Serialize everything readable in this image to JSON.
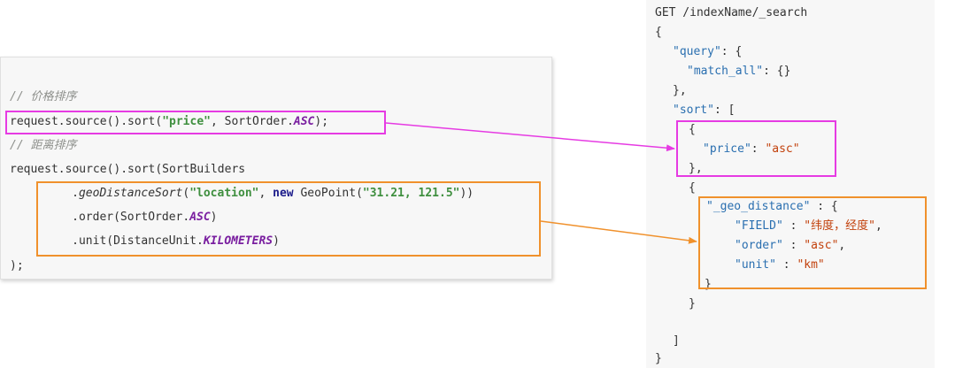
{
  "left_code": {
    "comment_price": "// 价格排序",
    "line_sort_price": {
      "prefix": "request.source().sort(",
      "arg": "\"price\"",
      "mid": ", SortOrder.",
      "const": "ASC",
      "suffix": ");"
    },
    "comment_distance": "// 距离排序",
    "line_sort_builders": "request.source().sort(SortBuilders",
    "line_geo": {
      "indent": "     .",
      "method": "geoDistanceSort",
      "open": "(",
      "arg1": "\"location\"",
      "sep": ", ",
      "kw_new": "new",
      "mid": " GeoPoint(",
      "arg2": "\"31.21, 121.5\"",
      "close": "))"
    },
    "line_order": {
      "text": "     .order(SortOrder.",
      "const": "ASC",
      "close": ")"
    },
    "line_unit": {
      "text": "     .unit(DistanceUnit.",
      "const": "KILOMETERS",
      "close": ")"
    },
    "line_end": ");"
  },
  "right_code": {
    "request_line": "GET /indexName/_search",
    "brace_open": "{",
    "query_key": "\"query\"",
    "query_rest": ": {",
    "match_all_key": "\"match_all\"",
    "match_all_rest": ": {}",
    "query_close": "},",
    "sort_key": "\"sort\"",
    "sort_rest": ": [",
    "obj1_open": "{",
    "price_key": "\"price\"",
    "colon": ": ",
    "price_val": "\"asc\"",
    "obj1_close": "},",
    "obj2_open": "{",
    "geo_key": "\"_geo_distance\"",
    "geo_rest": " : {",
    "field_key": "\"FIELD\"",
    "field_sep": " : ",
    "field_val": "\"纬度，经度\"",
    "field_comma": ",",
    "order_key": "\"order\"",
    "order_val": "\"asc\"",
    "unit_key": "\"unit\"",
    "unit_val": "\"km\"",
    "geo_close": "}",
    "obj2_close": "}",
    "array_close": "]",
    "brace_close": "}"
  },
  "colors": {
    "magenta": "#e63be3",
    "orange": "#f0912c"
  }
}
